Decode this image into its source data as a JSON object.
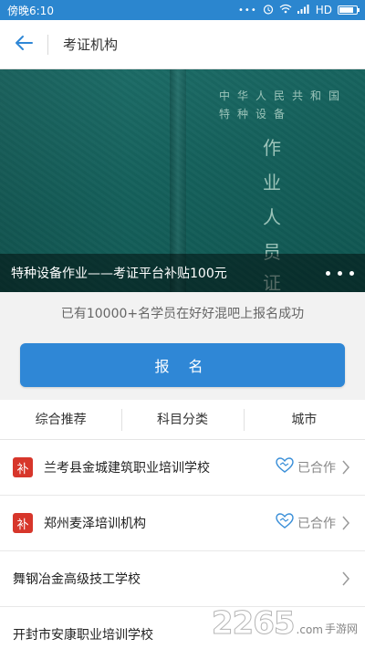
{
  "status_bar": {
    "time": "傍晚6:10",
    "network": "HD",
    "icons": [
      "dots-icon",
      "alarm-icon",
      "wifi-icon",
      "signal-icon",
      "battery-icon"
    ],
    "battery_level": 0.85
  },
  "nav": {
    "back_icon": "arrow-left-icon",
    "title": "考证机构"
  },
  "banner": {
    "cover_lines": [
      "中华人民共和国",
      "特种设备"
    ],
    "cover_big": [
      "作",
      "业",
      "人",
      "员",
      "证"
    ],
    "caption": "特种设备作业——考证平台补贴100元",
    "dots_count": 3
  },
  "stat_line": "已有10000+名学员在好好混吧上报名成功",
  "register_button": "报 名",
  "filter_tabs": [
    "综合推荐",
    "科目分类",
    "城市"
  ],
  "schools": [
    {
      "name": "兰考县金城建筑职业培训学校",
      "badge": "补",
      "partner": "已合作"
    },
    {
      "name": "郑州麦泽培训机构",
      "badge": "补",
      "partner": "已合作"
    },
    {
      "name": "舞钢冶金高级技工学校",
      "badge": "",
      "partner": ""
    },
    {
      "name": "开封市安康职业培训学校",
      "badge": "",
      "partner": ""
    }
  ],
  "watermark": {
    "number": "2265",
    "suffix": ".com",
    "site": "手游网"
  },
  "colors": {
    "status_bar": "#2b86cf",
    "primary_button": "#2f87d6",
    "badge_red": "#d7362b",
    "partner_blue": "#3a8fd8"
  }
}
